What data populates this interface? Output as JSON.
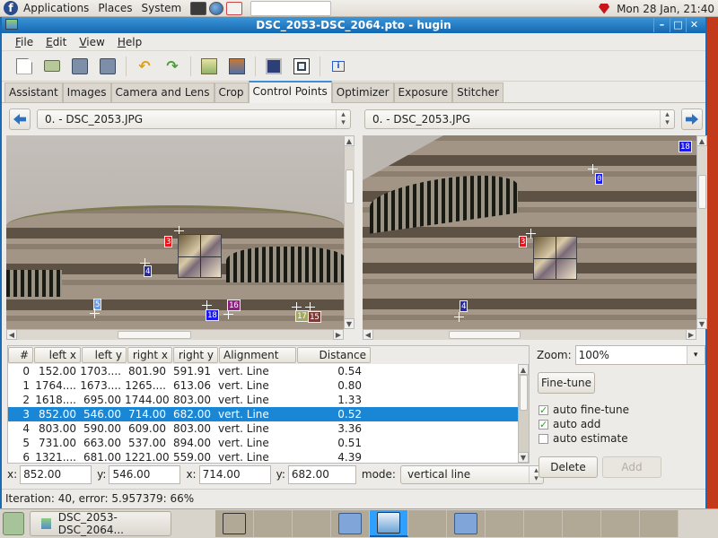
{
  "top_panel": {
    "menus": [
      "Applications",
      "Places",
      "System"
    ],
    "launchers": [
      "terminal-icon",
      "web-browser-icon",
      "help-book-icon"
    ],
    "clock": "Mon 28 Jan, 21:40"
  },
  "window": {
    "title": "DSC_2053-DSC_2064.pto - hugin",
    "controls": {
      "minimize": "–",
      "maximize": "□",
      "close": "✕"
    }
  },
  "menubar": {
    "items": [
      {
        "mnemonic": "F",
        "rest": "ile"
      },
      {
        "mnemonic": "E",
        "rest": "dit"
      },
      {
        "mnemonic": "V",
        "rest": "iew"
      },
      {
        "mnemonic": "H",
        "rest": "elp"
      }
    ]
  },
  "toolbar": {
    "buttons": [
      "new-project",
      "open-project",
      "save-project",
      "save-project-as",
      "undo",
      "redo",
      "add-images",
      "add-time-series",
      "preview-panorama",
      "control-points-table",
      "show-info"
    ]
  },
  "tabs": {
    "items": [
      "Assistant",
      "Images",
      "Camera and Lens",
      "Crop",
      "Control Points",
      "Optimizer",
      "Exposure",
      "Stitcher"
    ],
    "active": "Control Points"
  },
  "left_image": {
    "selected": "0. - DSC_2053.JPG",
    "points": [
      {
        "label": "3",
        "color": "#e8141a"
      },
      {
        "label": "4",
        "color": "#2a2a9a"
      },
      {
        "label": "5",
        "color": "#6b9be0"
      },
      {
        "label": "18",
        "color": "#1a1aee"
      },
      {
        "label": "16",
        "color": "#8e2080"
      },
      {
        "label": "17",
        "color": "#a3a862"
      },
      {
        "label": "15",
        "color": "#7a3a3a"
      }
    ]
  },
  "right_image": {
    "selected": "0. - DSC_2053.JPG",
    "points": [
      {
        "label": "18",
        "color": "#1a1aee"
      },
      {
        "label": "0",
        "color": "#1a1aee"
      },
      {
        "label": "3",
        "color": "#e8141a"
      },
      {
        "label": "4",
        "color": "#2a2a9a"
      }
    ]
  },
  "table": {
    "columns": [
      "#",
      "left x",
      "left y",
      "right x",
      "right y",
      "Alignment",
      "Distance"
    ],
    "rows": [
      [
        "0",
        "152.00",
        "1703....",
        "801.90",
        "591.91",
        "vert. Line",
        "0.54"
      ],
      [
        "1",
        "1764....",
        "1673....",
        "1265....",
        "613.06",
        "vert. Line",
        "0.80"
      ],
      [
        "2",
        "1618....",
        "695.00",
        "1744.00",
        "803.00",
        "vert. Line",
        "1.33"
      ],
      [
        "3",
        "852.00",
        "546.00",
        "714.00",
        "682.00",
        "vert. Line",
        "0.52"
      ],
      [
        "4",
        "803.00",
        "590.00",
        "609.00",
        "803.00",
        "vert. Line",
        "3.36"
      ],
      [
        "5",
        "731.00",
        "663.00",
        "537.00",
        "894.00",
        "vert. Line",
        "0.51"
      ],
      [
        "6",
        "1321....",
        "681.00",
        "1221.00",
        "559.00",
        "vert. Line",
        "4.39"
      ]
    ],
    "selected_index": 3
  },
  "coords": {
    "left_x_label": "x:",
    "left_x": "852.00",
    "left_y_label": "y:",
    "left_y": "546.00",
    "right_x_label": "x:",
    "right_x": "714.00",
    "right_y_label": "y:",
    "right_y": "682.00",
    "mode_label": "mode:",
    "mode": "vertical line"
  },
  "controls": {
    "zoom_label": "Zoom:",
    "zoom_value": "100%",
    "fine_tune": "Fine-tune",
    "auto_fine_tune": {
      "label": "auto fine-tune",
      "checked": true
    },
    "auto_add": {
      "label": "auto add",
      "checked": true
    },
    "auto_estimate": {
      "label": "auto estimate",
      "checked": false
    },
    "delete": "Delete",
    "add": "Add"
  },
  "status": "Iteration: 40, error: 5.957379: 66%",
  "taskbar": {
    "task_label": "DSC_2053-DSC_2064...",
    "workspaces": [
      "terminal",
      "",
      "",
      "folder",
      "hugin",
      "",
      "folder",
      "",
      "",
      "",
      "",
      ""
    ],
    "active_workspace": 4
  }
}
